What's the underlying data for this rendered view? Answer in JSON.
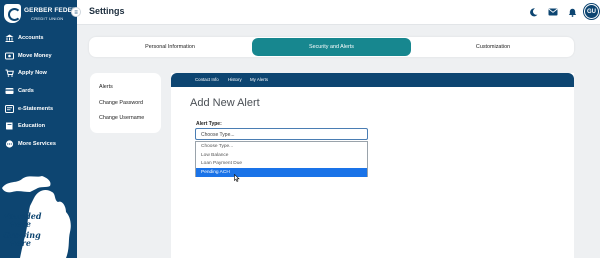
{
  "brand": {
    "name": "GERBER FEDERAL",
    "sub": "CREDIT UNION",
    "badge": "GERBER"
  },
  "sidebar": {
    "items": [
      {
        "label": "Accounts",
        "icon": "bank-icon"
      },
      {
        "label": "Move Money",
        "icon": "transfer-icon"
      },
      {
        "label": "Apply Now",
        "icon": "cart-icon"
      },
      {
        "label": "Cards",
        "icon": "card-icon"
      },
      {
        "label": "e-Statements",
        "icon": "statement-icon"
      },
      {
        "label": "Education",
        "icon": "book-icon"
      },
      {
        "label": "More Services",
        "icon": "more-icon"
      }
    ],
    "tagline": [
      "Founded",
      "Here",
      "Growing",
      "Here"
    ]
  },
  "header": {
    "title": "Settings",
    "avatar_initials": "GU"
  },
  "tabs": [
    {
      "label": "Personal Information",
      "active": false
    },
    {
      "label": "Security and Alerts",
      "active": true
    },
    {
      "label": "Customization",
      "active": false
    }
  ],
  "side_menu": {
    "items": [
      "Alerts",
      "Change Password",
      "Change Username"
    ]
  },
  "alerts_nav": {
    "links": [
      "Contact Info",
      "History",
      "My Alerts"
    ]
  },
  "form": {
    "title": "Add New Alert",
    "alert_type_label": "Alert Type:",
    "select_value": "Choose Type...",
    "options": [
      "Choose Type...",
      "Low Balance",
      "Loan Payment Due",
      "Pending ACH"
    ],
    "highlighted_option": "Pending ACH"
  },
  "colors": {
    "primary": "#0d4571",
    "accent": "#17878f",
    "highlight": "#1a73e8",
    "background": "#eef0f2"
  }
}
